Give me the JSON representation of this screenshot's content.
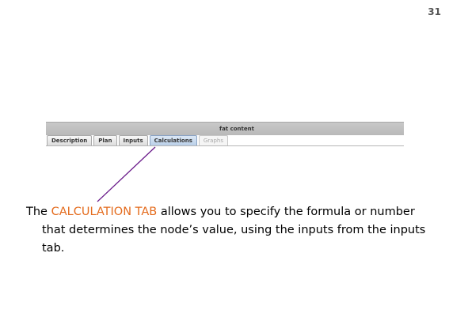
{
  "slide": {
    "number": "31"
  },
  "window": {
    "title": "fat content"
  },
  "tabs": [
    {
      "label": "Description",
      "state": "normal"
    },
    {
      "label": "Plan",
      "state": "normal"
    },
    {
      "label": "Inputs",
      "state": "normal"
    },
    {
      "label": "Calculations",
      "state": "selected"
    },
    {
      "label": "Graphs",
      "state": "disabled"
    }
  ],
  "caption": {
    "prefix": "The ",
    "highlight": "CALCULATION TAB",
    "rest": " allows you to specify the formula or number that determines the node’s value, using the inputs from the inputs tab.",
    "highlight_color": "#e46c1e"
  },
  "pointer": {
    "color": "#6a1b8a"
  }
}
